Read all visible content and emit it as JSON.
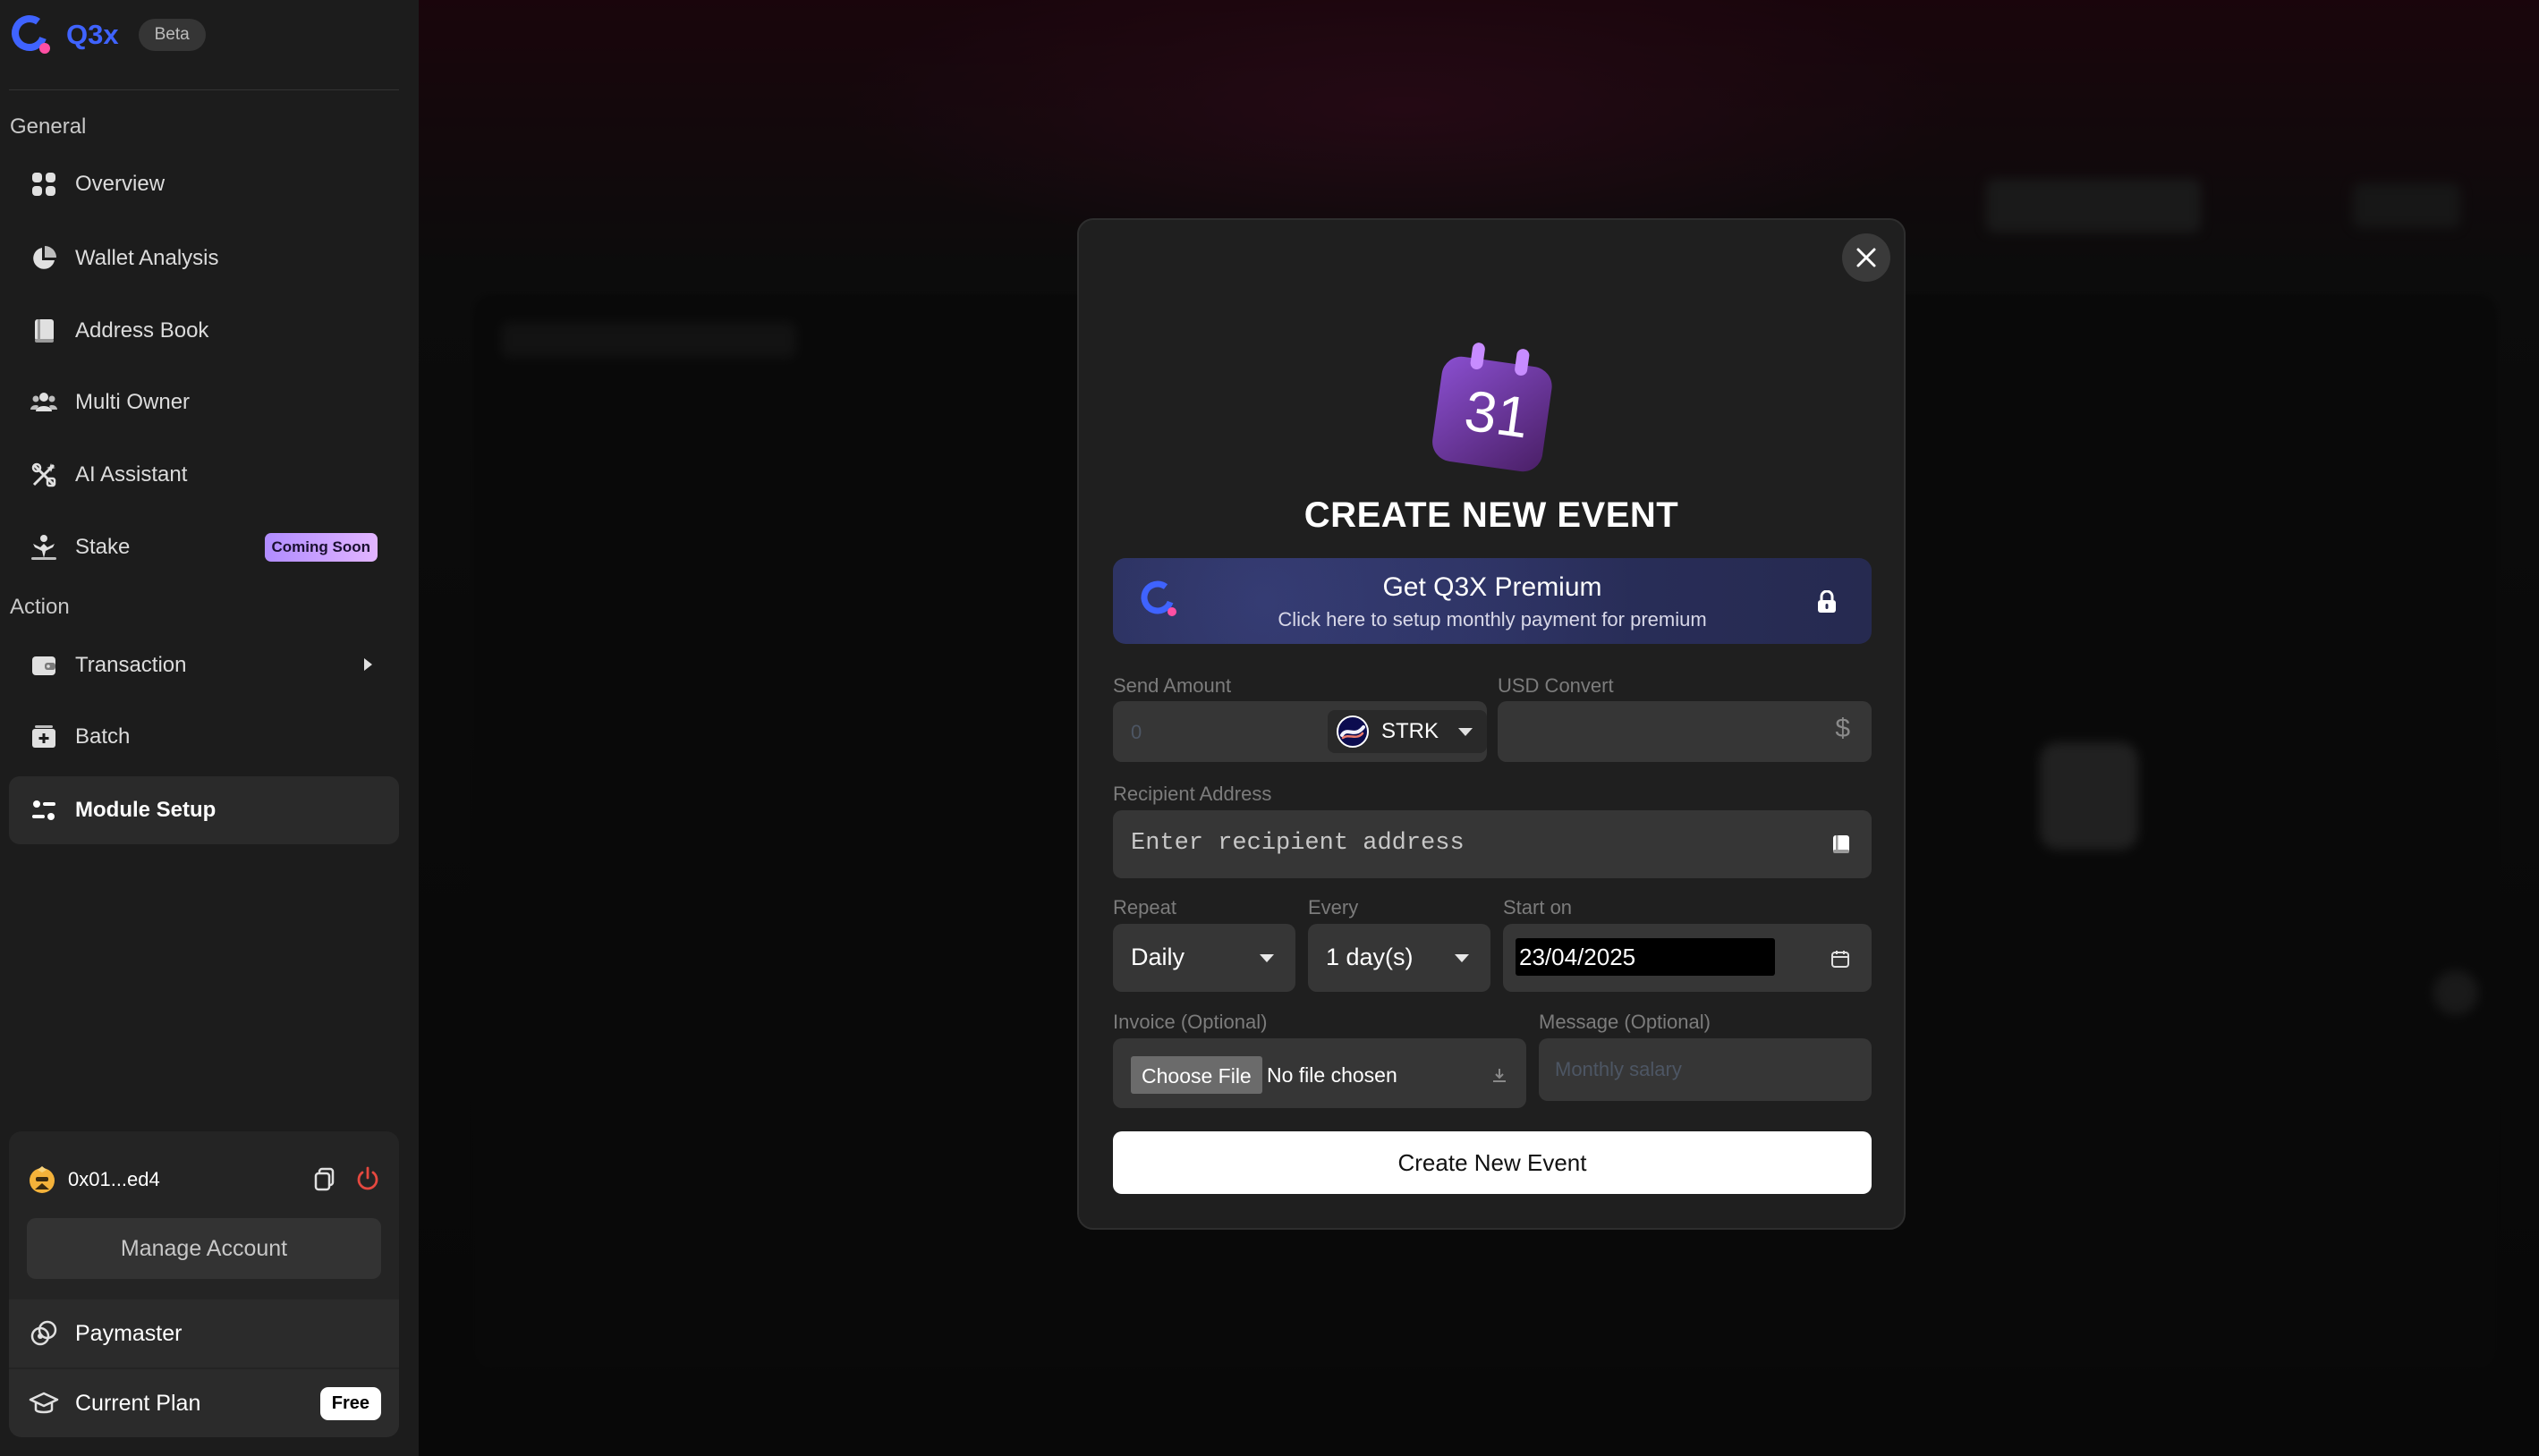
{
  "app": {
    "name": "Q3x",
    "badge": "Beta",
    "brand_color": "#3f63ff"
  },
  "sidebar": {
    "sections": [
      {
        "title": "General"
      },
      {
        "title": "Action"
      }
    ],
    "items": [
      {
        "label": "Overview",
        "icon": "grid-icon"
      },
      {
        "label": "Wallet Analysis",
        "icon": "pie-chart-icon"
      },
      {
        "label": "Address Book",
        "icon": "book-icon"
      },
      {
        "label": "Multi Owner",
        "icon": "users-icon"
      },
      {
        "label": "AI Assistant",
        "icon": "ai-icon"
      },
      {
        "label": "Stake",
        "icon": "stake-icon",
        "badge": "Coming Soon"
      },
      {
        "label": "Transaction",
        "icon": "wallet-icon"
      },
      {
        "label": "Batch",
        "icon": "batch-icon"
      },
      {
        "label": "Module Setup",
        "icon": "module-icon",
        "active": true
      }
    ],
    "account": {
      "address": "0x01...ed4",
      "manage_label": "Manage Account",
      "paymaster_label": "Paymaster",
      "plan_label": "Current Plan",
      "plan_badge": "Free",
      "power_color": "#e5483f"
    }
  },
  "modal": {
    "title": "CREATE NEW EVENT",
    "calendar_day": "31",
    "premium": {
      "title": "Get Q3X Premium",
      "subtitle": "Click here to setup monthly payment for premium"
    },
    "send_amount": {
      "label": "Send Amount",
      "placeholder": "0",
      "token": "STRK"
    },
    "usd_convert": {
      "label": "USD Convert",
      "symbol": "$"
    },
    "recipient": {
      "label": "Recipient Address",
      "placeholder": "Enter recipient address"
    },
    "repeat": {
      "label": "Repeat",
      "value": "Daily"
    },
    "every": {
      "label": "Every",
      "value": "1 day(s)"
    },
    "start_on": {
      "label": "Start on",
      "value": "23/04/2025"
    },
    "invoice": {
      "label": "Invoice (Optional)",
      "button_label": "Choose File",
      "status": "No file chosen"
    },
    "message": {
      "label": "Message (Optional)",
      "placeholder": "Monthly salary"
    },
    "submit_label": "Create New Event"
  }
}
